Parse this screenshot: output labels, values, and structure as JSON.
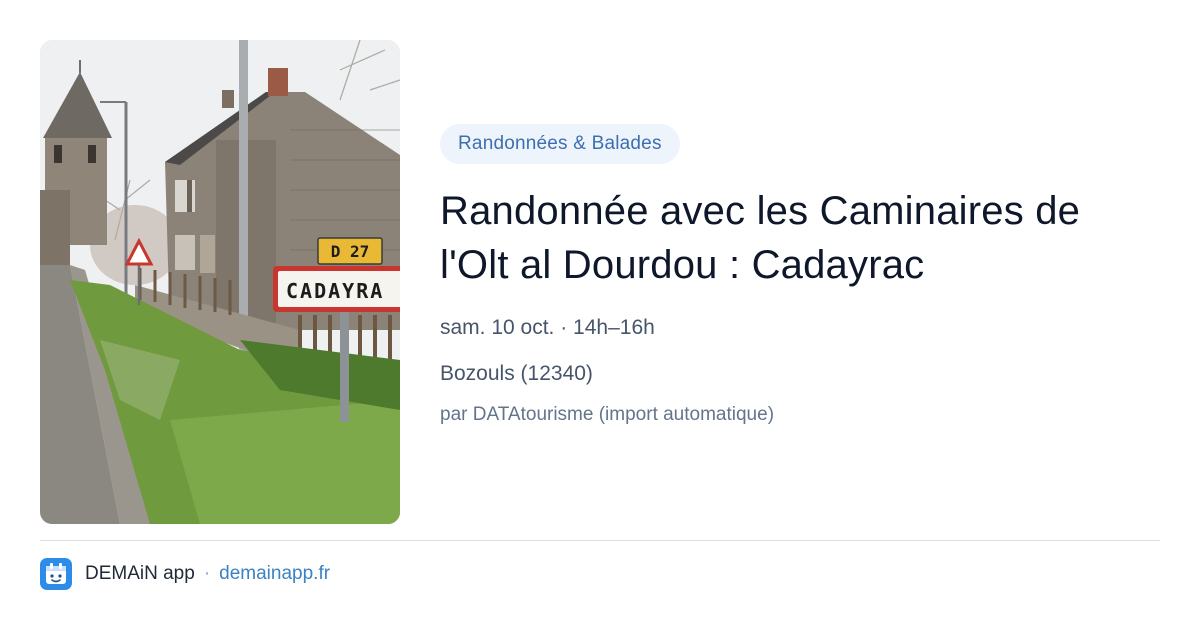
{
  "photo": {
    "road_sign_label": "D 27",
    "town_sign_label": "CADAYRA"
  },
  "event": {
    "category": "Randonnées & Balades",
    "title": "Randonnée avec les Caminaires de l'Olt al Dourdou : Cadayrac",
    "when": "sam. 10 oct. · 14h–16h",
    "where": "Bozouls (12340)",
    "source": "par DATAtourisme (import automatique)"
  },
  "footer": {
    "app_name": "DEMAiN app",
    "separator": "·",
    "domain": "demainapp.fr",
    "logo_icon": "calendar-face-icon"
  },
  "colors": {
    "category_bg": "#eef4fc",
    "category_text": "#3d6fb0",
    "link": "#3b82c4",
    "logo_bg": "#2d8ce8"
  }
}
